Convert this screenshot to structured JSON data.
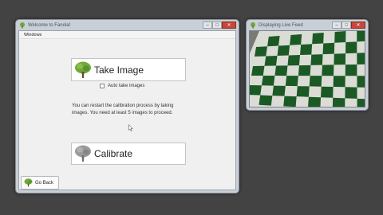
{
  "main_window": {
    "title": "Welcome to Fanola!",
    "minimize": "–",
    "maximize": "□",
    "close": "✕",
    "menu": [
      "Windows"
    ],
    "take_image_label": "Take Image",
    "auto_take_label": "Auto take images",
    "auto_take_checked": false,
    "info_text": "You can restart the calibration process by taking images. You need at least 5 images to proceed.",
    "calibrate_label": "Calibrate",
    "go_back_label": "Go Back"
  },
  "feed_window": {
    "title": "Displaying Live Feed",
    "minimize": "–",
    "maximize": "□",
    "close": "✕"
  },
  "icons": {
    "tree_active": "tree-icon",
    "tree_disabled": "tree-icon-gray"
  },
  "colors": {
    "desktop": "#434343",
    "tree_green": "#6fa83a",
    "tree_gray": "#9a9a9a",
    "board_green": "#1b5a24"
  }
}
